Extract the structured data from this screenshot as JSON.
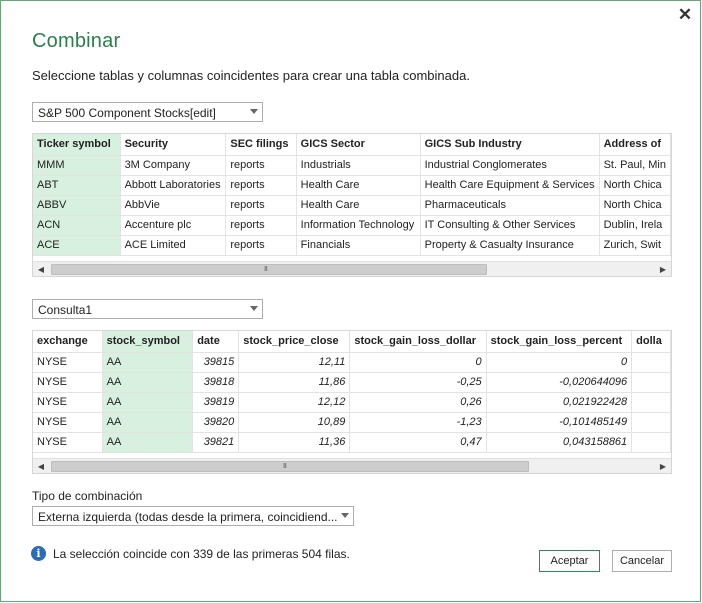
{
  "dialog": {
    "title": "Combinar",
    "subtitle": "Seleccione tablas y columnas coincidentes para crear una tabla combinada.",
    "close_glyph": "✕"
  },
  "table1": {
    "dropdown": "S&P 500 Component Stocks[edit]",
    "columns": [
      "Ticker symbol",
      "Security",
      "SEC filings",
      "GICS Sector",
      "GICS Sub Industry",
      "Address of"
    ],
    "rows": [
      [
        "MMM",
        "3M Company",
        "reports",
        "Industrials",
        "Industrial Conglomerates",
        "St. Paul, Min"
      ],
      [
        "ABT",
        "Abbott Laboratories",
        "reports",
        "Health Care",
        "Health Care Equipment & Services",
        "North Chica"
      ],
      [
        "ABBV",
        "AbbVie",
        "reports",
        "Health Care",
        "Pharmaceuticals",
        "North Chica"
      ],
      [
        "ACN",
        "Accenture plc",
        "reports",
        "Information Technology",
        "IT Consulting & Other Services",
        "Dublin, Irela"
      ],
      [
        "ACE",
        "ACE Limited",
        "reports",
        "Financials",
        "Property & Casualty Insurance",
        "Zurich, Swit"
      ]
    ],
    "selected_column": 0,
    "scroll_left": "◀",
    "scroll_right": "▶",
    "grip": "III"
  },
  "table2": {
    "dropdown": "Consulta1",
    "columns": [
      "exchange",
      "stock_symbol",
      "date",
      "stock_price_close",
      "stock_gain_loss_dollar",
      "stock_gain_loss_percent",
      "dolla"
    ],
    "rows": [
      [
        "NYSE",
        "AA",
        "39815",
        "12,11",
        "0",
        "0",
        ""
      ],
      [
        "NYSE",
        "AA",
        "39818",
        "11,86",
        "-0,25",
        "-0,020644096",
        ""
      ],
      [
        "NYSE",
        "AA",
        "39819",
        "12,12",
        "0,26",
        "0,021922428",
        ""
      ],
      [
        "NYSE",
        "AA",
        "39820",
        "10,89",
        "-1,23",
        "-0,101485149",
        ""
      ],
      [
        "NYSE",
        "AA",
        "39821",
        "11,36",
        "0,47",
        "0,043158861",
        ""
      ]
    ],
    "numeric_columns": [
      2,
      3,
      4,
      5
    ],
    "selected_column": 1,
    "scroll_left": "◀",
    "scroll_right": "▶",
    "grip": "III"
  },
  "join": {
    "label": "Tipo de combinación",
    "value": "Externa izquierda (todas desde la primera, coincidiend..."
  },
  "footer": {
    "info_glyph": "i",
    "message": "La selección coincide con 339 de las primeras 504 filas.",
    "ok_label": "Aceptar",
    "cancel_label": "Cancelar"
  },
  "colors": {
    "accent": "#2e7d4d",
    "selected_column": "#d8f0e0",
    "info": "#2b6cb8"
  }
}
